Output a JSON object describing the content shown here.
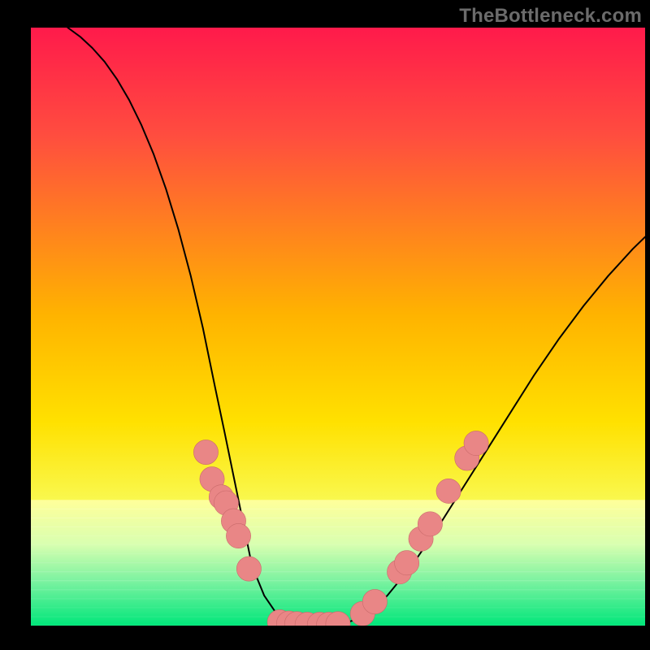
{
  "watermark": "TheBottleneck.com",
  "chart_data": {
    "type": "line",
    "title": "",
    "xlabel": "",
    "ylabel": "",
    "xlim": [
      0,
      100
    ],
    "ylim": [
      0,
      100
    ],
    "grid": false,
    "legend": false,
    "background_gradient": {
      "top": "#ff1a4b",
      "mid": "#ffe100",
      "bottom": "#00e67a"
    },
    "bottom_band": {
      "color_top": "#ffff9a",
      "color_bottom": "#00e67a",
      "y_top": 21,
      "y_bottom": 0
    },
    "series": [
      {
        "name": "curve",
        "stroke": "#000000",
        "x": [
          6,
          8,
          10,
          12,
          14,
          16,
          18,
          20,
          22,
          24,
          26,
          28,
          30,
          31.5,
          33,
          34.5,
          36,
          38,
          40,
          42,
          44,
          46,
          48,
          50,
          52,
          54,
          56,
          58,
          60,
          63,
          66,
          70,
          74,
          78,
          82,
          86,
          90,
          94,
          98,
          100
        ],
        "y": [
          100,
          98.5,
          96.6,
          94.3,
          91.4,
          87.9,
          83.7,
          78.8,
          73.0,
          66.3,
          58.6,
          49.8,
          39.8,
          32.5,
          25.0,
          17.5,
          10.0,
          5.0,
          2.0,
          0.6,
          0.2,
          0.1,
          0.1,
          0.3,
          0.7,
          1.5,
          3.0,
          5.0,
          7.5,
          11.5,
          16.0,
          22.5,
          29.0,
          35.5,
          42.0,
          48.0,
          53.5,
          58.5,
          63.0,
          65.0
        ]
      }
    ],
    "dots": {
      "color": "#e98686",
      "radius": 2.0,
      "points": [
        {
          "x": 28.5,
          "y": 29.0
        },
        {
          "x": 29.5,
          "y": 24.5
        },
        {
          "x": 31.0,
          "y": 21.5
        },
        {
          "x": 31.8,
          "y": 20.5
        },
        {
          "x": 33.0,
          "y": 17.5
        },
        {
          "x": 33.8,
          "y": 15.0
        },
        {
          "x": 35.5,
          "y": 9.5
        },
        {
          "x": 40.5,
          "y": 0.6
        },
        {
          "x": 42.0,
          "y": 0.4
        },
        {
          "x": 43.3,
          "y": 0.3
        },
        {
          "x": 45.0,
          "y": 0.2
        },
        {
          "x": 47.0,
          "y": 0.2
        },
        {
          "x": 48.5,
          "y": 0.2
        },
        {
          "x": 50.0,
          "y": 0.3
        },
        {
          "x": 54.0,
          "y": 2.0
        },
        {
          "x": 56.0,
          "y": 4.0
        },
        {
          "x": 60.0,
          "y": 9.0
        },
        {
          "x": 61.2,
          "y": 10.5
        },
        {
          "x": 63.5,
          "y": 14.5
        },
        {
          "x": 65.0,
          "y": 17.0
        },
        {
          "x": 68.0,
          "y": 22.5
        },
        {
          "x": 71.0,
          "y": 28.0
        },
        {
          "x": 72.5,
          "y": 30.5
        }
      ]
    }
  }
}
